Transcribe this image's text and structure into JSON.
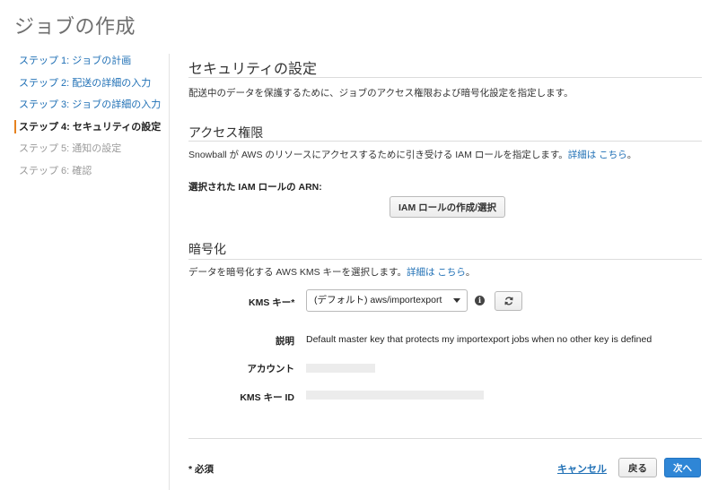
{
  "page": {
    "title": "ジョブの作成"
  },
  "sidebar": {
    "steps": [
      {
        "label": "ステップ 1: ジョブの計画",
        "state": "link"
      },
      {
        "label": "ステップ 2: 配送の詳細の入力",
        "state": "link"
      },
      {
        "label": "ステップ 3: ジョブの詳細の入力",
        "state": "link"
      },
      {
        "label": "ステップ 4: セキュリティの設定",
        "state": "active"
      },
      {
        "label": "ステップ 5: 通知の設定",
        "state": "disabled"
      },
      {
        "label": "ステップ 6: 確認",
        "state": "disabled"
      }
    ]
  },
  "security": {
    "heading": "セキュリティの設定",
    "description": "配送中のデータを保護するために、ジョブのアクセス権限および暗号化設定を指定します。"
  },
  "access": {
    "heading": "アクセス権限",
    "description": "Snowball が AWS のリソースにアクセスするために引き受ける IAM ロールを指定します。",
    "details_link": "詳細は こちら",
    "details_suffix": "。",
    "arn_label": "選択された IAM ロールの ARN:",
    "create_role_button": "IAM ロールの作成/選択"
  },
  "encryption": {
    "heading": "暗号化",
    "description": "データを暗号化する AWS KMS キーを選択します。",
    "details_link": "詳細は こちら",
    "details_suffix": "。",
    "kms_key_label": "KMS キー*",
    "kms_key_selected": "(デフォルト) aws/importexport",
    "info_icon": "info-icon",
    "refresh_icon": "refresh-icon",
    "description_label": "説明",
    "description_value": "Default master key that protects my importexport jobs when no other key is defined",
    "account_label": "アカウント",
    "kms_id_label": "KMS キー ID"
  },
  "footer": {
    "required_note": "* 必須",
    "cancel": "キャンセル",
    "back": "戻る",
    "next": "次へ"
  },
  "colors": {
    "link": "#1e6fb5",
    "active_marker": "#e6821f",
    "primary_button": "#2f86d6"
  }
}
